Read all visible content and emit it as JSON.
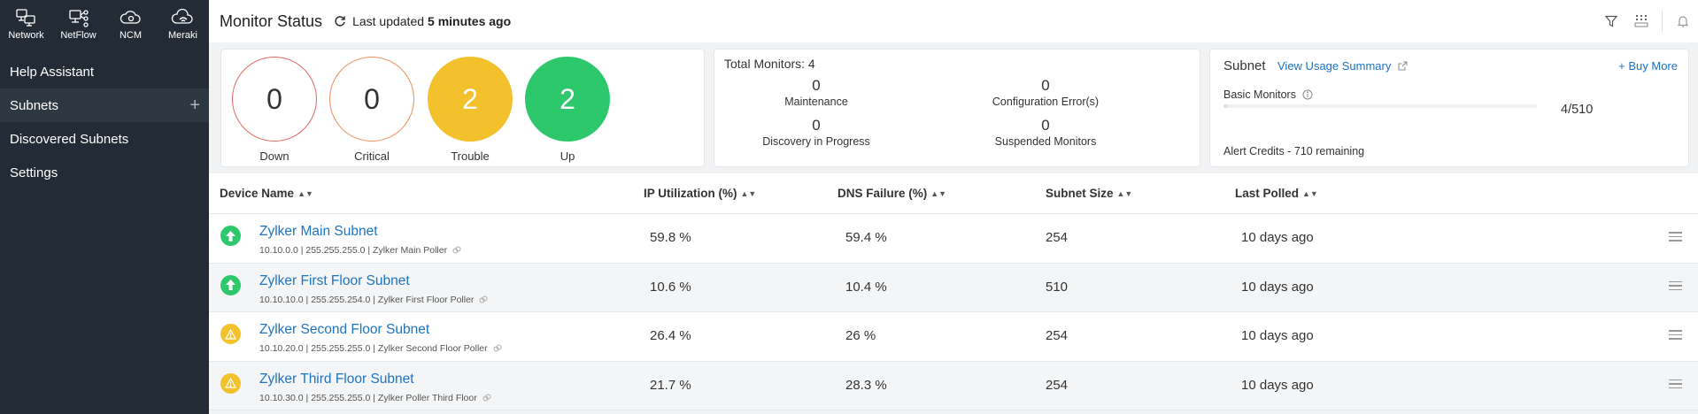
{
  "topnav": [
    {
      "label": "Network",
      "icon": "network-icon"
    },
    {
      "label": "NetFlow",
      "icon": "netflow-icon"
    },
    {
      "label": "NCM",
      "icon": "ncm-icon"
    },
    {
      "label": "Meraki",
      "icon": "meraki-icon"
    }
  ],
  "sidebar": {
    "items": [
      {
        "label": "Help Assistant"
      },
      {
        "label": "Subnets",
        "plus": "+"
      },
      {
        "label": "Discovered Subnets"
      },
      {
        "label": "Settings"
      }
    ]
  },
  "header": {
    "title": "Monitor Status",
    "updated_prefix": "Last updated",
    "updated_value": "5 minutes ago"
  },
  "status_summary": [
    {
      "label": "Down",
      "value": "0",
      "kind": "down"
    },
    {
      "label": "Critical",
      "value": "0",
      "kind": "critical"
    },
    {
      "label": "Trouble",
      "value": "2",
      "kind": "trouble"
    },
    {
      "label": "Up",
      "value": "2",
      "kind": "up"
    }
  ],
  "totals": {
    "title": "Total Monitors: 4",
    "stats": [
      {
        "value": "0",
        "label": "Maintenance"
      },
      {
        "value": "0",
        "label": "Configuration Error(s)"
      },
      {
        "value": "0",
        "label": "Discovery in Progress"
      },
      {
        "value": "0",
        "label": "Suspended Monitors"
      }
    ]
  },
  "subnet_card": {
    "title": "Subnet",
    "usage_link": "View Usage Summary",
    "buy_more": "+ Buy More",
    "basic_label": "Basic Monitors",
    "basic_count": "4/510",
    "basic_fraction": 0.0078,
    "alert_credits": "Alert Credits - 710 remaining"
  },
  "table": {
    "columns": [
      "Device Name",
      "IP Utilization (%)",
      "DNS Failure (%)",
      "Subnet Size",
      "Last Polled"
    ],
    "rows": [
      {
        "status": "up",
        "name": "Zylker Main Subnet",
        "details": "10.10.0.0 | 255.255.255.0 | Zylker Main Poller",
        "ip_util": "59.8 %",
        "dns_fail": "59.4 %",
        "size": "254",
        "polled": "10 days ago"
      },
      {
        "status": "up",
        "name": "Zylker First Floor Subnet",
        "details": "10.10.10.0 | 255.255.254.0 | Zylker First Floor Poller",
        "ip_util": "10.6 %",
        "dns_fail": "10.4 %",
        "size": "510",
        "polled": "10 days ago"
      },
      {
        "status": "trouble",
        "name": "Zylker Second Floor Subnet",
        "details": "10.10.20.0 | 255.255.255.0 | Zylker Second Floor Poller",
        "ip_util": "26.4 %",
        "dns_fail": "26 %",
        "size": "254",
        "polled": "10 days ago"
      },
      {
        "status": "trouble",
        "name": "Zylker Third Floor Subnet",
        "details": "10.10.30.0 | 255.255.255.0 | Zylker Poller Third Floor",
        "ip_util": "21.7 %",
        "dns_fail": "28.3 %",
        "size": "254",
        "polled": "10 days ago"
      }
    ]
  },
  "colors": {
    "sidebar": "#232c36",
    "link": "#1d74c4",
    "up": "#2ec86c",
    "trouble": "#f3c12c",
    "down": "#e0685f",
    "critical": "#ee8f5a"
  }
}
